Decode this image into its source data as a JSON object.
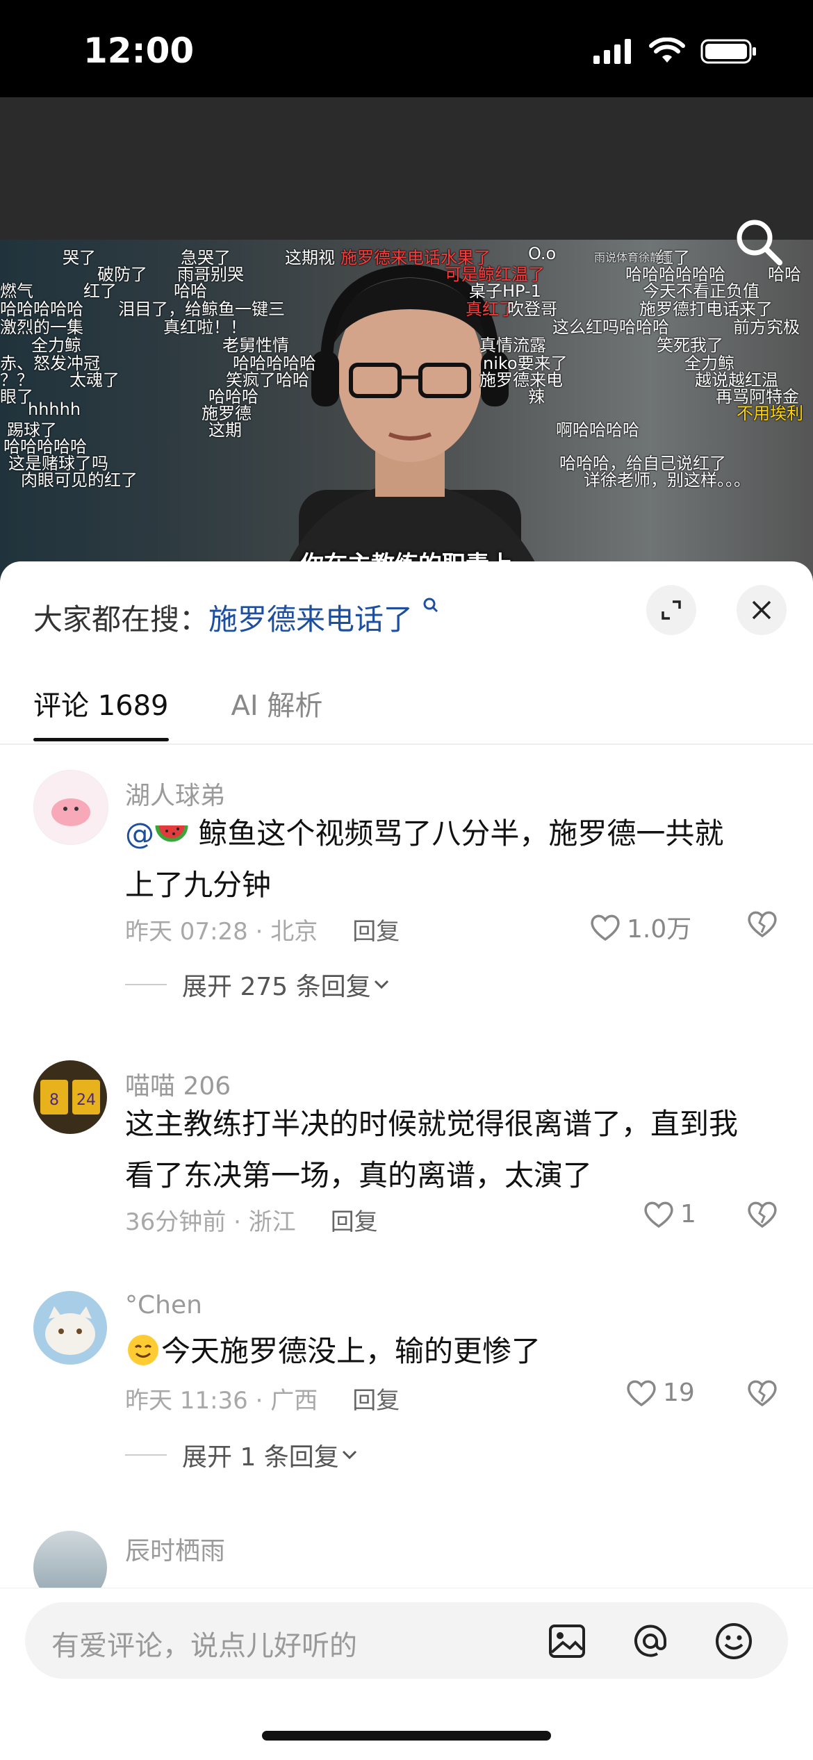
{
  "status": {
    "time": "12:00"
  },
  "video": {
    "subtitle": "你在主教练的职责上",
    "danmaku": [
      {
        "t": "哭了",
        "c": ""
      },
      {
        "t": "急哭了",
        "c": ""
      },
      {
        "t": "这期视",
        "c": ""
      },
      {
        "t": "施罗德来电话水果了",
        "c": "red"
      },
      {
        "t": "O.o",
        "c": ""
      },
      {
        "t": "红了",
        "c": ""
      },
      {
        "t": "破防了",
        "c": ""
      },
      {
        "t": "雨哥别哭",
        "c": ""
      },
      {
        "t": "可是鲸红温了",
        "c": "red"
      },
      {
        "t": "哈哈哈哈哈哈",
        "c": ""
      },
      {
        "t": "哈哈",
        "c": ""
      },
      {
        "t": "燃气",
        "c": ""
      },
      {
        "t": "红了",
        "c": ""
      },
      {
        "t": "哈哈",
        "c": ""
      },
      {
        "t": "桌子HP-1",
        "c": ""
      },
      {
        "t": "今天不看正负值",
        "c": ""
      },
      {
        "t": "哈哈哈哈哈",
        "c": ""
      },
      {
        "t": "泪目了，给鲸鱼一键三",
        "c": ""
      },
      {
        "t": "真红了",
        "c": "red"
      },
      {
        "t": "吹登哥",
        "c": ""
      },
      {
        "t": "施罗德打电话来了",
        "c": ""
      },
      {
        "t": "激烈的一集",
        "c": ""
      },
      {
        "t": "真红啦！！",
        "c": ""
      },
      {
        "t": "这么红吗哈哈哈",
        "c": ""
      },
      {
        "t": "前方究极",
        "c": ""
      },
      {
        "t": "全力鲸",
        "c": ""
      },
      {
        "t": "老舅性情",
        "c": ""
      },
      {
        "t": "真情流露",
        "c": ""
      },
      {
        "t": "笑死我了",
        "c": ""
      },
      {
        "t": "赤、怒发冲冠",
        "c": ""
      },
      {
        "t": "哈哈哈哈哈",
        "c": ""
      },
      {
        "t": "niko要来了",
        "c": ""
      },
      {
        "t": "全力鲸",
        "c": ""
      },
      {
        "t": "？？",
        "c": ""
      },
      {
        "t": "太魂了",
        "c": ""
      },
      {
        "t": "笑疯了哈哈",
        "c": ""
      },
      {
        "t": "施罗德来电",
        "c": ""
      },
      {
        "t": "越说越红温",
        "c": ""
      },
      {
        "t": "眼了",
        "c": ""
      },
      {
        "t": "哈哈哈",
        "c": ""
      },
      {
        "t": "辣",
        "c": ""
      },
      {
        "t": "再骂阿特金",
        "c": ""
      },
      {
        "t": "hhhhh",
        "c": ""
      },
      {
        "t": "施罗德",
        "c": ""
      },
      {
        "t": "不用埃利",
        "c": "yellow"
      },
      {
        "t": "踢球了",
        "c": ""
      },
      {
        "t": "这期",
        "c": ""
      },
      {
        "t": "啊哈哈哈哈",
        "c": ""
      },
      {
        "t": "哈哈哈哈哈",
        "c": ""
      },
      {
        "t": "这是赌球了吗",
        "c": ""
      },
      {
        "t": "哈哈哈，给自己说红了",
        "c": ""
      },
      {
        "t": "肉眼可见的红了",
        "c": ""
      },
      {
        "t": "详徐老师，别这样。。。",
        "c": ""
      },
      {
        "t": "雨说体育徐静雨",
        "c": ""
      }
    ]
  },
  "sheet": {
    "hot_label": "大家都在搜：",
    "hot_keyword": "施罗德来电话了",
    "tabs": [
      {
        "label": "评论 1689"
      },
      {
        "label": "AI 解析"
      }
    ]
  },
  "comments": [
    {
      "author": "湖人球弟",
      "mention": "@",
      "text1": " 鲸鱼这个视频骂了八分半，施罗德一共就",
      "text2": "上了九分钟",
      "time": "昨天 07:28 · 北京",
      "reply": "回复",
      "likes": "1.0万",
      "expand": "展开 275 条回复"
    },
    {
      "author": "喵喵 206",
      "text1": "这主教练打半决的时候就觉得很离谱了，直到我",
      "text2": "看了东决第一场，真的离谱，太演了",
      "time": "36分钟前 · 浙江",
      "reply": "回复",
      "likes": "1"
    },
    {
      "author": "°Chen",
      "text1": "今天施罗德没上，输的更惨了",
      "time": "昨天 11:36 · 广西",
      "reply": "回复",
      "likes": "19",
      "expand": "展开 1 条回复"
    },
    {
      "author": "辰时栖雨"
    }
  ],
  "input": {
    "placeholder": "有爱评论，说点儿好听的"
  },
  "colors": {
    "keyword": "#1e4f9f",
    "danmaku_red": "#ff3b3b",
    "danmaku_yellow": "#ffd400"
  }
}
